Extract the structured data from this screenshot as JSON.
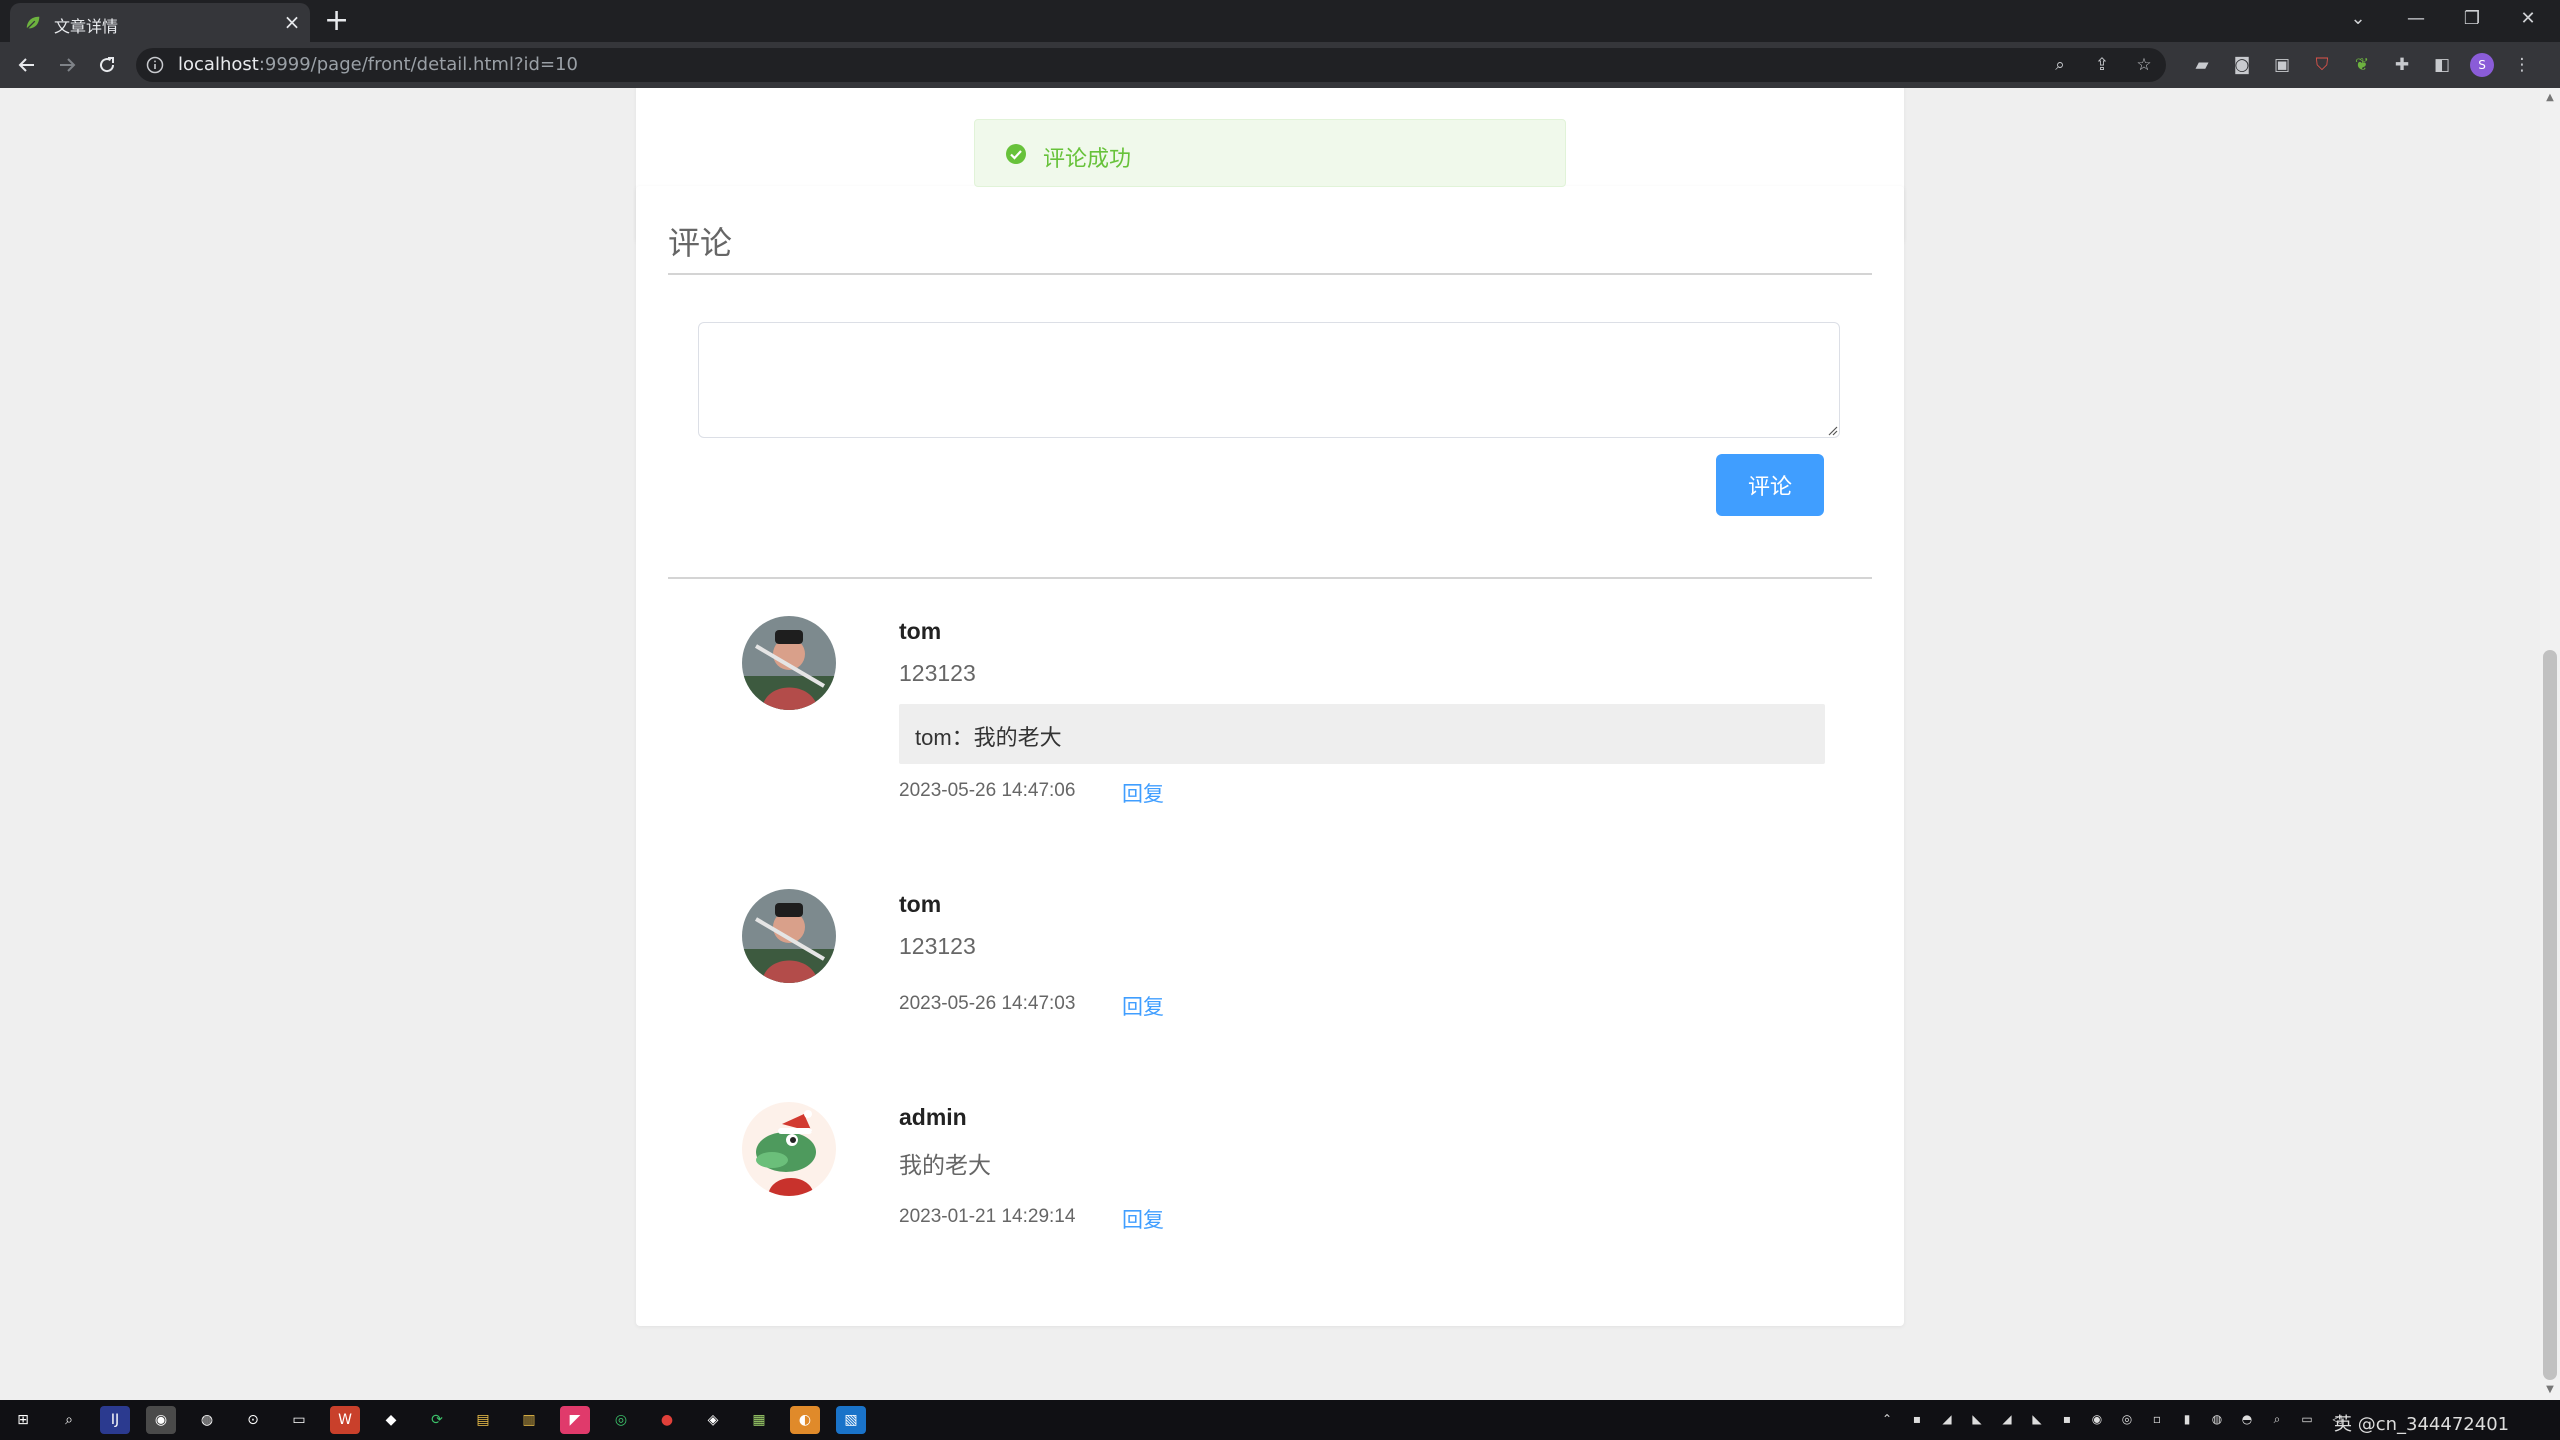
{
  "browser": {
    "tab_title": "文章详情",
    "tab_close": "×",
    "new_tab": "+",
    "url_host": "localhost",
    "url_rest": ":9999/page/front/detail.html?id=10",
    "window_controls": [
      "⌄",
      "—",
      "❐",
      "✕"
    ],
    "profile_initial": "S"
  },
  "toast": {
    "message": "评论成功",
    "type": "success"
  },
  "comment_section": {
    "title": "评论",
    "input_value": "",
    "submit_label": "评论"
  },
  "comments": [
    {
      "author": "tom",
      "content": "123123",
      "reply": "tom：我的老大",
      "time": "2023-05-26 14:47:06",
      "reply_label": "回复",
      "avatar": "photo-avatar"
    },
    {
      "author": "tom",
      "content": "123123",
      "time": "2023-05-26 14:47:03",
      "reply_label": "回复",
      "avatar": "photo-avatar"
    },
    {
      "author": "admin",
      "content": "我的老大",
      "time": "2023-01-21 14:29:14",
      "reply_label": "回复",
      "avatar": "crocodile-avatar"
    }
  ],
  "taskbar": {
    "tray_text": "英 @cn_344472401"
  },
  "colors": {
    "primary": "#409eff",
    "success": "#67c23a",
    "success_bg": "#f0f9eb",
    "page_bg": "#efefef"
  }
}
